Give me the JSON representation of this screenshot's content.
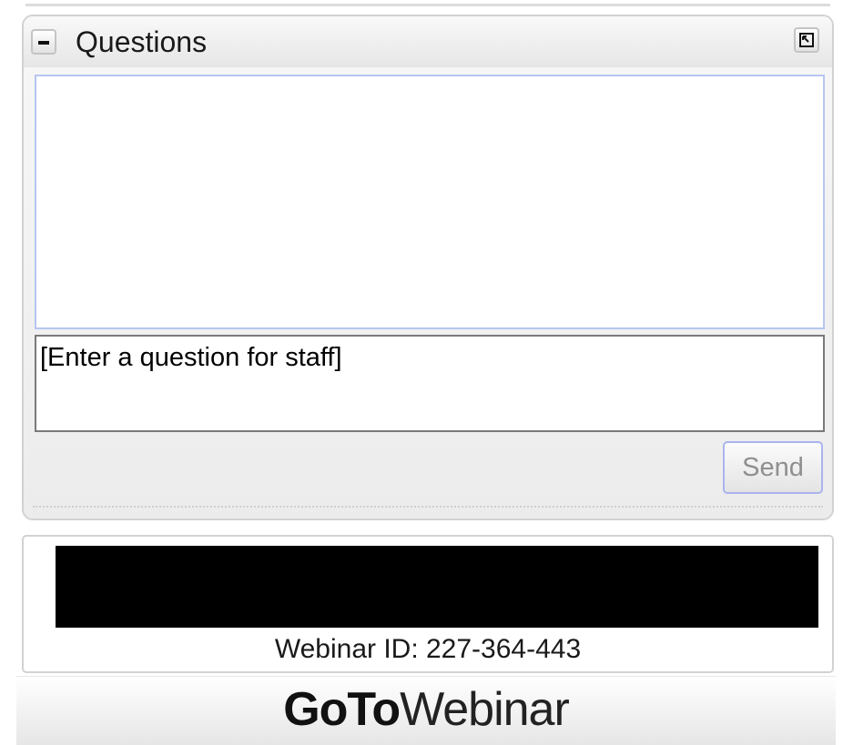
{
  "questions_panel": {
    "title": "Questions",
    "collapse_icon": "minus-icon",
    "popout_icon": "popout-icon",
    "input_placeholder": "[Enter a question for staff]",
    "input_value": "",
    "send_label": "Send"
  },
  "info_box": {
    "webinar_id": "Webinar ID: 227-364-443"
  },
  "footer": {
    "brand_bold": "GoTo",
    "brand_light": "Webinar"
  }
}
